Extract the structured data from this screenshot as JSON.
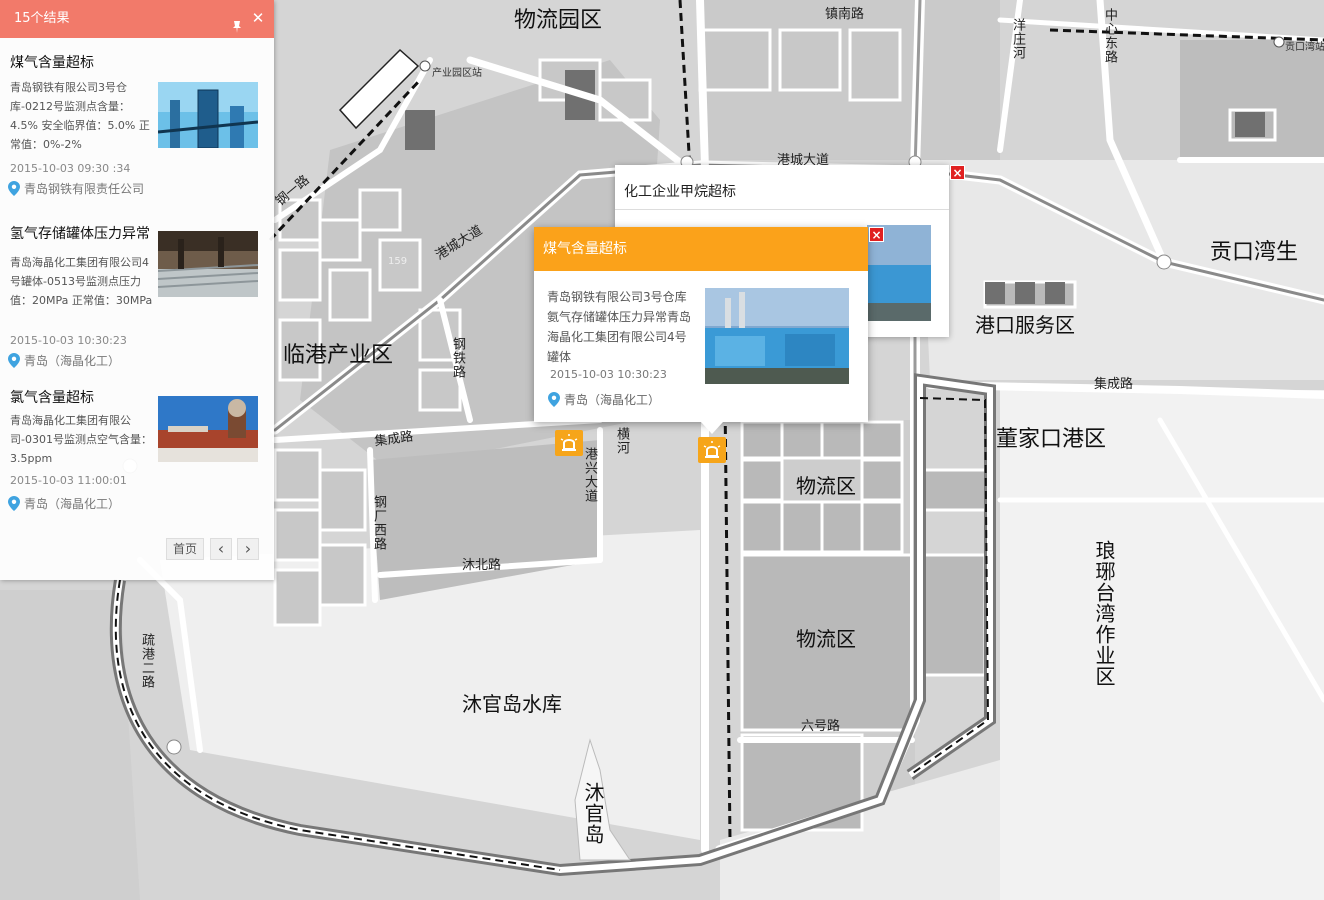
{
  "map": {
    "areas": {
      "wuliuyuan": "物流园区",
      "gongkou": "贡口湾生",
      "gangkou_service": "港口服务区",
      "dongjiakou": "董家口港区",
      "lingang": "临港产业区",
      "wuliu1": "物流区",
      "wuliu2": "物流区",
      "shuiku": "沐官岛水库",
      "mugd": "沐官岛",
      "langya": "琅琊台湾作业区"
    },
    "roads": {
      "zhennan": "镇南路",
      "gangcheng1": "港城大道",
      "gangcheng2": "港城大道",
      "jicheng1": "集成路",
      "jicheng2": "集成路",
      "mubei": "沐北路",
      "liuhao": "六号路",
      "ganglu": "钢一路",
      "gangchang": "钢厂西路",
      "gangyi": "钢铁路",
      "gangxing": "港兴大道",
      "henghe": "横河",
      "shugang": "疏港二路",
      "zhongxin": "中心东路",
      "pingze": "洋庄河",
      "station": "产业园区站",
      "gongkou_st": "贡口湾站",
      "num": "159"
    }
  },
  "results": {
    "header": "15个结果",
    "items": [
      {
        "title": "煤气含量超标",
        "desc": "青岛钢铁有限公司3号仓库-0212号监测点含量：4.5% 安全临界值：5.0%  正常值：0%-2%",
        "time": "2015-10-03 09:30 :34",
        "location": "青岛钢铁有限责任公司"
      },
      {
        "title": "氢气存储罐体压力异常",
        "desc": "青岛海晶化工集团有限公司4号罐体-0513号监测点压力值：20MPa  正常值：30MPa",
        "time": "2015-10-03 10:30:23",
        "location": "青岛（海晶化工）"
      },
      {
        "title": "氯气含量超标",
        "desc": "青岛海晶化工集团有限公司-0301号监测点空气含量：3.5ppm",
        "time": "2015-10-03 11:00:01",
        "location": "青岛（海晶化工）"
      }
    ],
    "pager": {
      "first": "首页",
      "prev": "‹",
      "next": "›"
    }
  },
  "popup_back": {
    "title": "化工企业甲烷超标",
    "close": "×"
  },
  "popup_front": {
    "title": "煤气含量超标",
    "desc": "青岛钢铁有限公司3号仓库氨气存储罐体压力异常青岛海晶化工集团有限公司4号罐体",
    "time": "2015-10-03 10:30:23",
    "location": "青岛（海晶化工）",
    "close": "×"
  },
  "colors": {
    "header": "#f27a6a",
    "popup_head": "#fba21a",
    "marker": "#f6a51a",
    "close": "#e02020"
  }
}
